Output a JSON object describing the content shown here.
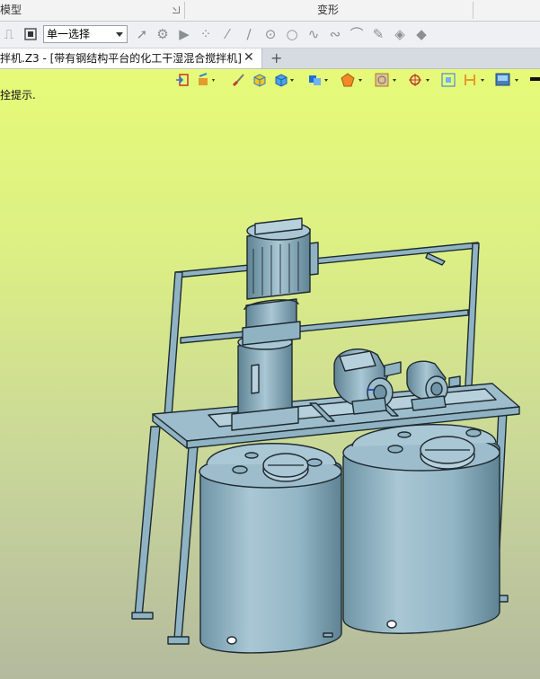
{
  "ribbon": {
    "group_left": "模型",
    "group_center": "变形"
  },
  "toolbar": {
    "selection_mode": "单一选择"
  },
  "tabs": [
    {
      "title": "拌机.Z3 - [带有钢结构平台的化工干湿混合搅拌机]",
      "close_glyph": "✕"
    }
  ],
  "new_tab_glyph": "+",
  "viewport": {
    "prompt_text": "拴提示.",
    "background_top": "#e6fa78",
    "background_bottom": "#b4ba9e",
    "model_color": "#8fb3c3"
  },
  "view_toolbar_icons": [
    "exit-sketch-icon",
    "shaded-display-icon",
    "brush-icon",
    "cube-yellow-icon",
    "cube-view-icon",
    "layer-icon",
    "render-mode-icon",
    "orient-icon",
    "filter-icon",
    "pick-icon",
    "fit-view-icon",
    "measure-icon",
    "display-settings-icon"
  ]
}
